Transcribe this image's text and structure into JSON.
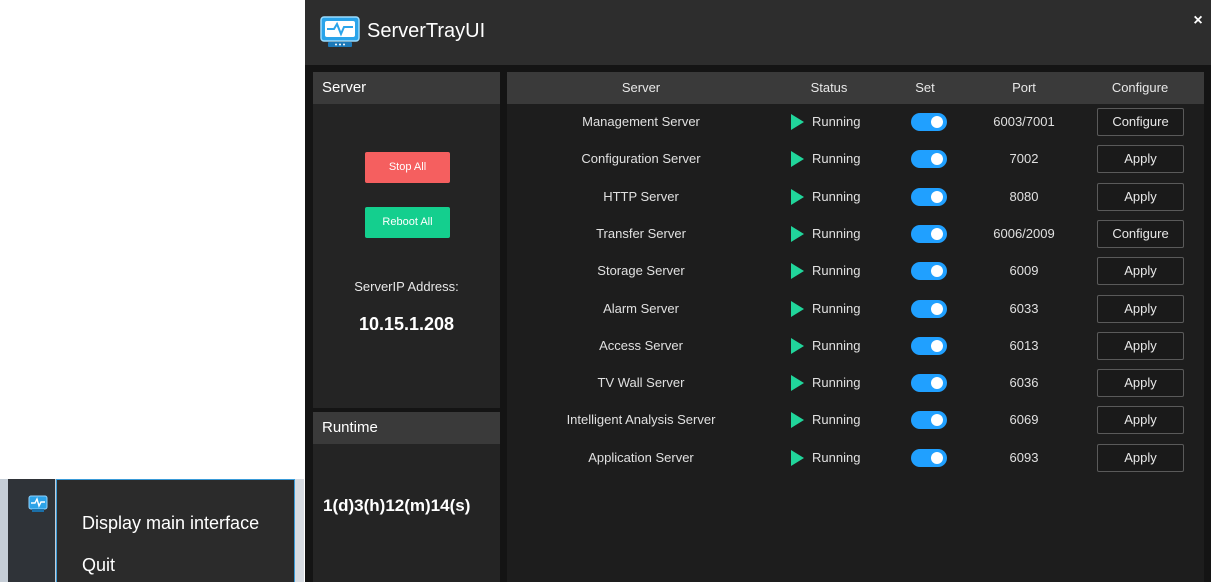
{
  "tray_menu": {
    "items": [
      {
        "label": "Display main interface"
      },
      {
        "label": "Quit"
      }
    ]
  },
  "window": {
    "title": "ServerTrayUI",
    "close_glyph": "×"
  },
  "server_panel": {
    "header": "Server",
    "stop_all_label": "Stop All",
    "reboot_all_label": "Reboot All",
    "ip_label": "ServerIP Address:",
    "ip_value": "10.15.1.208"
  },
  "runtime_panel": {
    "header": "Runtime",
    "value": "1(d)3(h)12(m)14(s)"
  },
  "table": {
    "headers": {
      "server": "Server",
      "status": "Status",
      "set": "Set",
      "port": "Port",
      "configure": "Configure"
    },
    "rows": [
      {
        "name": "Management Server",
        "status": "Running",
        "enabled": true,
        "port": "6003/7001",
        "action": "Configure"
      },
      {
        "name": "Configuration Server",
        "status": "Running",
        "enabled": true,
        "port": "7002",
        "action": "Apply"
      },
      {
        "name": "HTTP Server",
        "status": "Running",
        "enabled": true,
        "port": "8080",
        "action": "Apply"
      },
      {
        "name": "Transfer Server",
        "status": "Running",
        "enabled": true,
        "port": "6006/2009",
        "action": "Configure"
      },
      {
        "name": "Storage Server",
        "status": "Running",
        "enabled": true,
        "port": "6009",
        "action": "Apply"
      },
      {
        "name": "Alarm Server",
        "status": "Running",
        "enabled": true,
        "port": "6033",
        "action": "Apply"
      },
      {
        "name": "Access Server",
        "status": "Running",
        "enabled": true,
        "port": "6013",
        "action": "Apply"
      },
      {
        "name": "TV Wall Server",
        "status": "Running",
        "enabled": true,
        "port": "6036",
        "action": "Apply"
      },
      {
        "name": "Intelligent Analysis Server",
        "status": "Running",
        "enabled": true,
        "port": "6069",
        "action": "Apply"
      },
      {
        "name": "Application Server",
        "status": "Running",
        "enabled": true,
        "port": "6093",
        "action": "Apply"
      }
    ]
  },
  "colors": {
    "accent_blue": "#20a0ff",
    "running_green": "#21d59b",
    "stop_red": "#f55f5f",
    "reboot_green": "#14cf8e"
  },
  "icons": {
    "app": "server-monitor-icon",
    "tray": "server-monitor-icon",
    "status": "play-icon",
    "close": "close-icon"
  }
}
